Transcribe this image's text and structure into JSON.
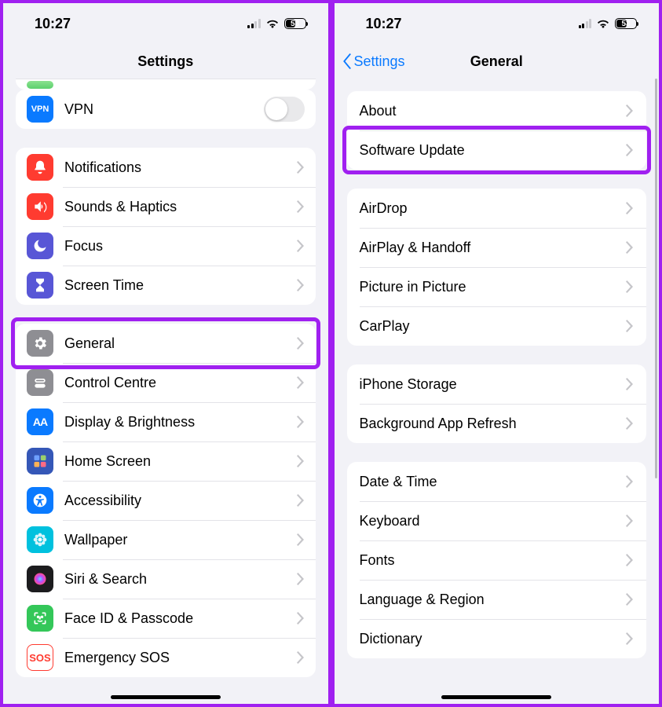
{
  "statusbar": {
    "time": "10:27",
    "battery_pct": "53"
  },
  "left": {
    "title": "Settings",
    "vpn": {
      "label": "VPN",
      "on": false
    },
    "groupA": [
      {
        "label": "Notifications",
        "icon": "bell",
        "color": "#ff3b30"
      },
      {
        "label": "Sounds & Haptics",
        "icon": "speaker",
        "color": "#ff3b30"
      },
      {
        "label": "Focus",
        "icon": "moon",
        "color": "#5856d6"
      },
      {
        "label": "Screen Time",
        "icon": "hourglass",
        "color": "#5856d6"
      }
    ],
    "groupB": [
      {
        "label": "General",
        "icon": "gear",
        "color": "#8e8e93"
      },
      {
        "label": "Control Centre",
        "icon": "switches",
        "color": "#8e8e93"
      },
      {
        "label": "Display & Brightness",
        "icon": "aa",
        "color": "#0a7aff"
      },
      {
        "label": "Home Screen",
        "icon": "grid",
        "color": "#3557b7"
      },
      {
        "label": "Accessibility",
        "icon": "accessibility",
        "color": "#0a7aff"
      },
      {
        "label": "Wallpaper",
        "icon": "flower",
        "color": "#00c1de"
      },
      {
        "label": "Siri & Search",
        "icon": "siri",
        "color": "#1c1c1e"
      },
      {
        "label": "Face ID & Passcode",
        "icon": "faceid",
        "color": "#34c759"
      },
      {
        "label": "Emergency SOS",
        "icon": "sos",
        "color": "#ffffff"
      }
    ],
    "highlight_index_in_groupB": 0
  },
  "right": {
    "back_label": "Settings",
    "title": "General",
    "groups": [
      [
        {
          "label": "About"
        },
        {
          "label": "Software Update"
        }
      ],
      [
        {
          "label": "AirDrop"
        },
        {
          "label": "AirPlay & Handoff"
        },
        {
          "label": "Picture in Picture"
        },
        {
          "label": "CarPlay"
        }
      ],
      [
        {
          "label": "iPhone Storage"
        },
        {
          "label": "Background App Refresh"
        }
      ],
      [
        {
          "label": "Date & Time"
        },
        {
          "label": "Keyboard"
        },
        {
          "label": "Fonts"
        },
        {
          "label": "Language & Region"
        },
        {
          "label": "Dictionary"
        }
      ]
    ],
    "highlight": {
      "group": 0,
      "row": 1
    }
  }
}
